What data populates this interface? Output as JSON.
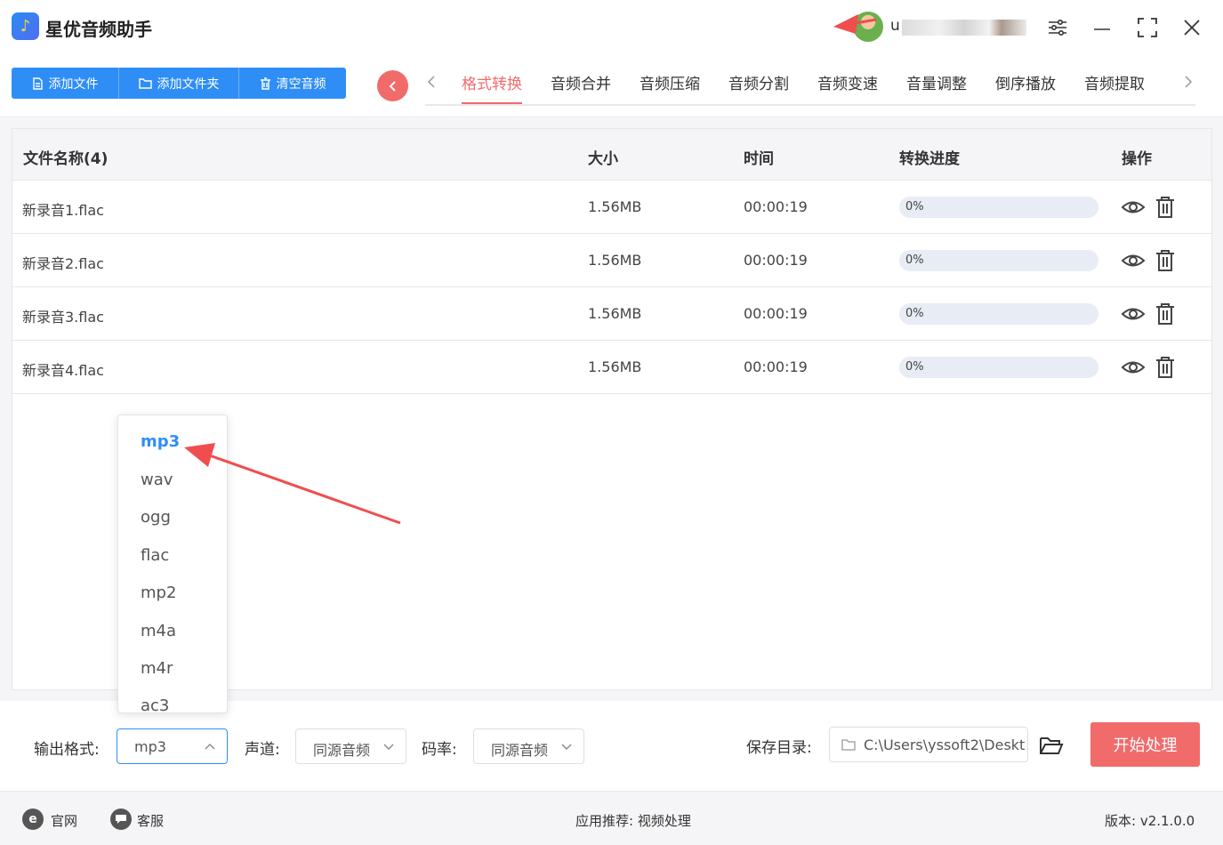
{
  "app": {
    "title": "星优音频助手",
    "username": "u"
  },
  "toolbar": {
    "add_file": "添加文件",
    "add_folder": "添加文件夹",
    "clear_audio": "清空音频"
  },
  "tabs": [
    {
      "label": "格式转换",
      "active": true
    },
    {
      "label": "音频合并",
      "active": false
    },
    {
      "label": "音频压缩",
      "active": false
    },
    {
      "label": "音频分割",
      "active": false
    },
    {
      "label": "音频变速",
      "active": false
    },
    {
      "label": "音量调整",
      "active": false
    },
    {
      "label": "倒序播放",
      "active": false
    },
    {
      "label": "音频提取",
      "active": false
    }
  ],
  "table": {
    "headers": {
      "name": "文件名称(4)",
      "size": "大小",
      "time": "时间",
      "progress": "转换进度",
      "ops": "操作"
    },
    "rows": [
      {
        "name": "新录音1.flac",
        "size": "1.56MB",
        "time": "00:00:19",
        "progress": "0%",
        "progress_value": 0
      },
      {
        "name": "新录音2.flac",
        "size": "1.56MB",
        "time": "00:00:19",
        "progress": "0%",
        "progress_value": 0
      },
      {
        "name": "新录音3.flac",
        "size": "1.56MB",
        "time": "00:00:19",
        "progress": "0%",
        "progress_value": 0
      },
      {
        "name": "新录音4.flac",
        "size": "1.56MB",
        "time": "00:00:19",
        "progress": "0%",
        "progress_value": 0
      }
    ]
  },
  "format_dropdown": {
    "options": [
      "mp3",
      "wav",
      "ogg",
      "flac",
      "mp2",
      "m4a",
      "m4r",
      "ac3"
    ],
    "selected": "mp3"
  },
  "settings": {
    "output_format_label": "输出格式:",
    "output_format_value": "mp3",
    "channel_label": "声道:",
    "channel_value": "同源音频",
    "bitrate_label": "码率:",
    "bitrate_value": "同源音频",
    "save_dir_label": "保存目录:",
    "save_dir_value": "C:\\Users\\yssoft2\\Deskt",
    "start_button": "开始处理"
  },
  "footer": {
    "website": "官网",
    "support": "客服",
    "recommend": "应用推荐:  视频处理",
    "version": "版本:  v2.1.0.0"
  },
  "colors": {
    "accent_blue": "#2f8ef5",
    "accent_red": "#f16b6b",
    "annotation_red": "#f04e4e"
  },
  "icons": [
    "app-logo-icon",
    "settings-sliders-icon",
    "minimize-icon",
    "maximize-icon",
    "close-icon",
    "file-icon",
    "folder-icon",
    "trash-icon",
    "back-icon",
    "chevron-left-icon",
    "chevron-right-icon",
    "eye-icon",
    "delete-icon",
    "chevron-down-icon",
    "chevron-up-icon",
    "folder-open-icon",
    "ie-icon",
    "chat-icon"
  ]
}
